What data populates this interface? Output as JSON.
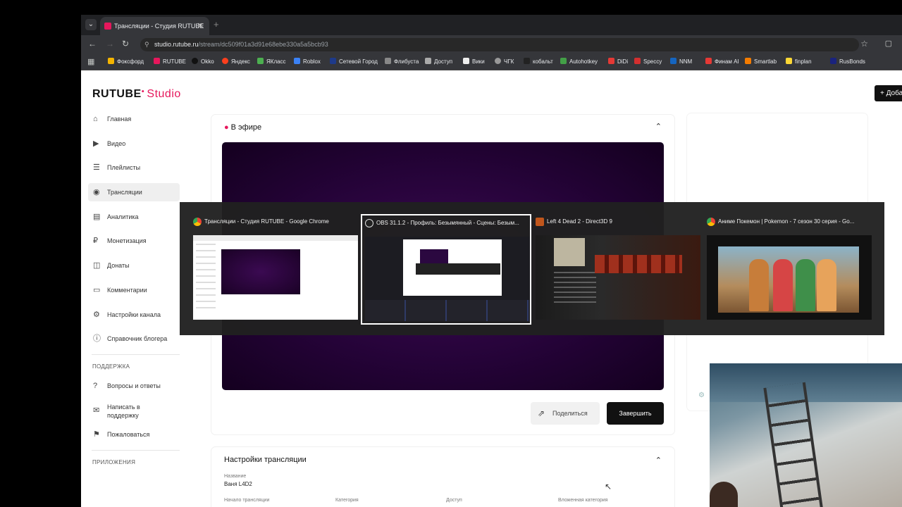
{
  "browser": {
    "tab_title": "Трансляции - Студия RUTUBE",
    "tab_close": "✕",
    "new_tab": "+",
    "url_host": "studio.rutube.ru",
    "url_path": "/stream/dc509f01a3d91e68ebe330a5a5bcb93",
    "bookmarks": [
      "Фоксфорд",
      "RUTUBE",
      "Okko",
      "Яндекс",
      "ЯКласс",
      "Roblox",
      "Сетевой Город",
      "Флибуста",
      "Доступ",
      "Вики",
      "ЧГК",
      "кобальт",
      "Autohotkey",
      "DiDi",
      "Speccy",
      "NNM",
      "Финам AI",
      "Smartlab",
      "finplan",
      "RusBonds"
    ]
  },
  "header": {
    "logo_main": "RUTUBE",
    "logo_studio": "Studio",
    "add_button": "+ Доба"
  },
  "sidebar": {
    "items": [
      {
        "label": "Главная",
        "icon": "home-icon"
      },
      {
        "label": "Видео",
        "icon": "video-icon"
      },
      {
        "label": "Плейлисты",
        "icon": "playlist-icon"
      },
      {
        "label": "Трансляции",
        "icon": "broadcast-icon"
      },
      {
        "label": "Аналитика",
        "icon": "analytics-icon"
      },
      {
        "label": "Монетизация",
        "icon": "monetization-icon"
      },
      {
        "label": "Донаты",
        "icon": "donate-icon"
      },
      {
        "label": "Комментарии",
        "icon": "comments-icon"
      },
      {
        "label": "Настройки канала",
        "icon": "settings-icon"
      },
      {
        "label": "Справочник блогера",
        "icon": "info-icon"
      }
    ],
    "support_header": "ПОДДЕРЖКА",
    "support_items": [
      {
        "label": "Вопросы и ответы",
        "icon": "question-icon"
      },
      {
        "label": "Написать в поддержку",
        "icon": "mail-icon"
      },
      {
        "label": "Пожаловаться",
        "icon": "flag-icon"
      }
    ],
    "apps_header": "ПРИЛОЖЕНИЯ"
  },
  "stream": {
    "status": "В эфире",
    "share_button": "Поделиться",
    "end_button": "Завершить"
  },
  "settings": {
    "title": "Настройки трансляции",
    "name_label": "Название",
    "name_value": "Ваня L4D2",
    "start_label": "Начало трансляции",
    "category_label": "Категория",
    "access_label": "Доступ",
    "subcategory_label": "Вложенная категория"
  },
  "switcher": {
    "windows": [
      {
        "title": "Трансляции - Студия RUTUBE - Google Chrome",
        "icon_color": "#4285f4"
      },
      {
        "title": "OBS 31.1.2 - Профиль: Безымянный - Сцены: Безым...",
        "icon_color": "#2b2b2b"
      },
      {
        "title": "Left 4 Dead 2 - Direct3D 9",
        "icon_color": "#c0561c"
      },
      {
        "title": "Аниме Покемон | Pokemon - 7 сезон 30 серия - Go...",
        "icon_color": "#4285f4"
      }
    ],
    "selected_index": 1
  },
  "colors": {
    "accent": "#e6175c",
    "live_video": "#250338"
  }
}
